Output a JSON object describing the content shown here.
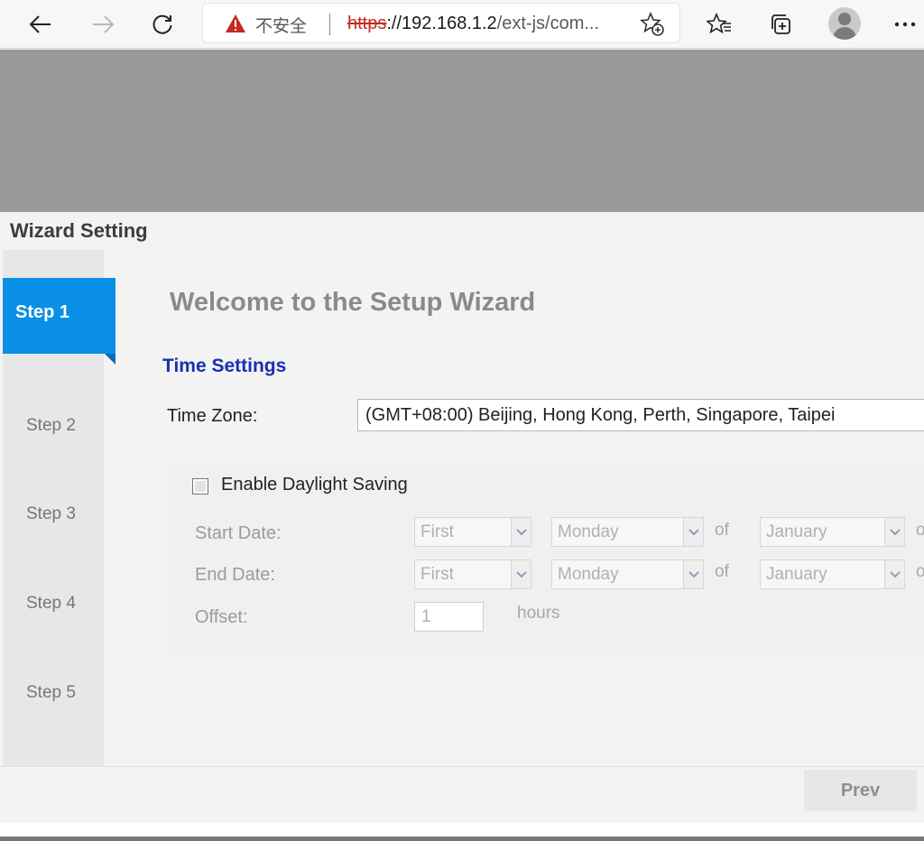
{
  "browser": {
    "security_text": "不安全",
    "url_protocol": "https",
    "url_rest": "://192.168.1.2",
    "url_tail": "/ext-js/com..."
  },
  "wizard": {
    "title": "Wizard Setting",
    "steps": [
      {
        "label": "Step 1",
        "active": true
      },
      {
        "label": "Step 2",
        "active": false
      },
      {
        "label": "Step 3",
        "active": false
      },
      {
        "label": "Step 4",
        "active": false
      },
      {
        "label": "Step 5",
        "active": false
      }
    ],
    "welcome": "Welcome to the Setup Wizard",
    "section_title": "Time Settings",
    "time_zone_label": "Time Zone:",
    "time_zone_value": "(GMT+08:00) Beijing, Hong Kong, Perth, Singapore, Taipei",
    "daylight": {
      "label": "Enable Daylight Saving",
      "checked": false,
      "start_label": "Start Date:",
      "end_label": "End Date:",
      "offset_label": "Offset:",
      "start": {
        "week": "First",
        "day": "Monday",
        "of": "of",
        "month": "January",
        "trailing": "o"
      },
      "end": {
        "week": "First",
        "day": "Monday",
        "of": "of",
        "month": "January",
        "trailing": "o"
      },
      "offset_value": "1",
      "offset_unit": "hours"
    },
    "prev_label": "Prev"
  },
  "colors": {
    "accent": "#0a8fe6",
    "section_title": "#1a2fb0",
    "banner": "#9a9a9a",
    "warning": "#c42b1c"
  }
}
